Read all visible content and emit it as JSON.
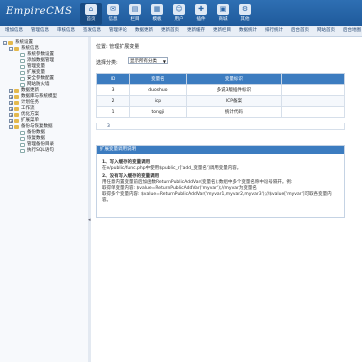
{
  "app": {
    "logo": "EmpireCMS"
  },
  "topnav": [
    {
      "label": "首页",
      "icon": "⌂",
      "active": true
    },
    {
      "label": "信息",
      "icon": "✉",
      "active": false
    },
    {
      "label": "栏目",
      "icon": "▤",
      "active": false
    },
    {
      "label": "模板",
      "icon": "▦",
      "active": false
    },
    {
      "label": "用户",
      "icon": "☺",
      "active": false
    },
    {
      "label": "插件",
      "icon": "✚",
      "active": false
    },
    {
      "label": "商城",
      "icon": "▣",
      "active": false
    },
    {
      "label": "其他",
      "icon": "⚙",
      "active": false
    }
  ],
  "menubar": [
    "增加信息",
    "管理信息",
    "审核信息",
    "签发信息",
    "管理评论",
    "数据更新",
    "更新首页",
    "更新缓存",
    "更新栏目",
    "数据统计",
    "排行统计",
    "后台首页",
    "网站首页",
    "后台地图"
  ],
  "sidebar": {
    "items": [
      {
        "label": "系统设置",
        "level": 0,
        "box": "-"
      },
      {
        "label": "系统信息",
        "level": 1,
        "box": "-"
      },
      {
        "label": "系统参数设置",
        "level": 2
      },
      {
        "label": "添加数据管理",
        "level": 2
      },
      {
        "label": "管理变量",
        "level": 2
      },
      {
        "label": "扩展变量",
        "level": 2
      },
      {
        "label": "安全参数配置",
        "level": 2
      },
      {
        "label": "网站防火墙",
        "level": 2
      },
      {
        "label": "数据更新",
        "level": 1,
        "box": "+"
      },
      {
        "label": "数据库与系统模型",
        "level": 1,
        "box": "+"
      },
      {
        "label": "计划任务",
        "level": 1,
        "box": "+"
      },
      {
        "label": "工作流",
        "level": 1,
        "box": "+"
      },
      {
        "label": "优化方案",
        "level": 1,
        "box": "+"
      },
      {
        "label": "扩展菜单",
        "level": 1,
        "box": "+"
      },
      {
        "label": "备份与恢复数据",
        "level": 1,
        "box": "-"
      },
      {
        "label": "备份数据",
        "level": 2
      },
      {
        "label": "恢复数据",
        "level": 2
      },
      {
        "label": "管理备份目录",
        "level": 2
      },
      {
        "label": "执行SQL语句",
        "level": 2
      }
    ]
  },
  "main": {
    "breadcrumb": "位置: 管理扩展变量",
    "filter_label": "选择分类:",
    "filter_value": "显示所有分类",
    "table": {
      "headers": [
        "ID",
        "变量名",
        "变量标识",
        ""
      ],
      "rows": [
        [
          "3",
          "duoshuo",
          "多说3版插件标识",
          ""
        ],
        [
          "2",
          "icp",
          "ICP备案",
          ""
        ],
        [
          "1",
          "tongji",
          "统计代码",
          ""
        ]
      ]
    },
    "pager": "3",
    "help": {
      "title": "扩展变量调用说明",
      "h1": "1、写入缓存的变量调用",
      "p1": "在e/public/func.php中使用$public_r['add_变量名']调用变量内容。",
      "h2": "2、没有写入缓存的变量调用",
      "p2": "用任意内置变量前后加函数ReturnPublicAddVar(变量名);数组中多个变量名称中逗号隔开。例:",
      "p3": "取得单变量内容: $value=ReturnPublicAddVar('myvar');//myvar为变量名",
      "p4": "取得多个变量内容: $value=ReturnPublicAddVar('myvar1,myvar2,myvar3');//$value['myvar']可取各变量内容。"
    }
  }
}
